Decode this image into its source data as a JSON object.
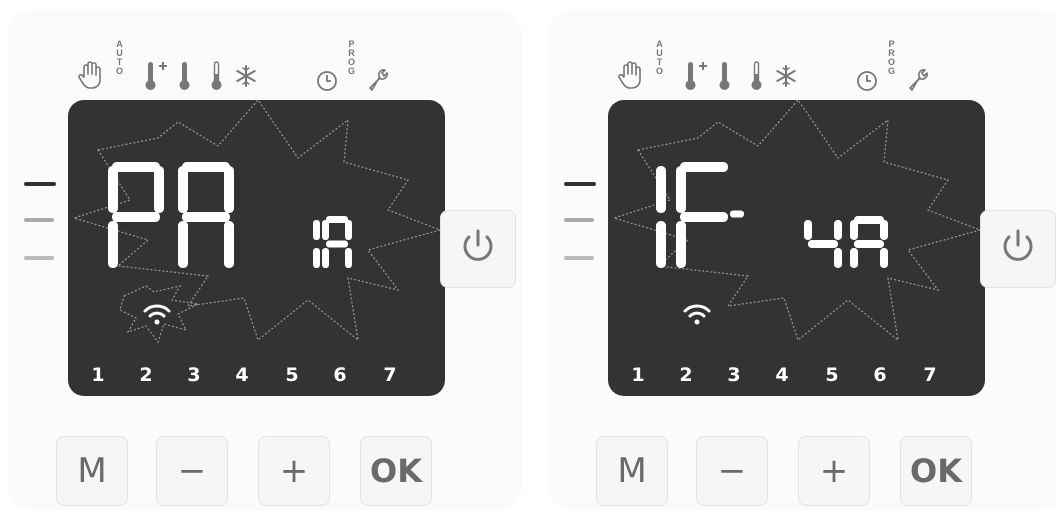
{
  "panels": [
    {
      "id": "left",
      "indicators": {
        "manual": "hand-icon",
        "auto_letters": [
          "A",
          "U",
          "T",
          "O"
        ],
        "comfort_plus": "thermometer-plus-icon",
        "comfort": "thermometer-icon",
        "eco": "thermometer-low-icon",
        "frost": "snowflake-icon",
        "clock": "clock-icon",
        "prog_letters": [
          "P",
          "R",
          "O",
          "G"
        ],
        "settings": "wrench-icon"
      },
      "display": {
        "main_text": "PA",
        "sub_text": "IR",
        "blinking": true
      },
      "days": [
        "1",
        "2",
        "3",
        "4",
        "5",
        "6",
        "7"
      ],
      "wifi": "wifi-icon",
      "power": "power-icon",
      "buttons": {
        "mode": "M",
        "minus": "−",
        "plus": "+",
        "ok": "OK"
      }
    },
    {
      "id": "right",
      "indicators": {
        "manual": "hand-icon",
        "auto_letters": [
          "A",
          "U",
          "T",
          "O"
        ],
        "comfort_plus": "thermometer-plus-icon",
        "comfort": "thermometer-icon",
        "eco": "thermometer-low-icon",
        "frost": "snowflake-icon",
        "clock": "clock-icon",
        "prog_letters": [
          "P",
          "R",
          "O",
          "G"
        ],
        "settings": "wrench-icon"
      },
      "display": {
        "main_text": "IF-",
        "sub_text": "4A",
        "blinking": true
      },
      "days": [
        "1",
        "2",
        "3",
        "4",
        "5",
        "6",
        "7"
      ],
      "wifi": "wifi-icon",
      "power": "power-icon",
      "buttons": {
        "mode": "M",
        "minus": "−",
        "plus": "+",
        "ok": "OK"
      }
    }
  ],
  "colors": {
    "lcd_bg": "#333333",
    "segment": "#ffffff",
    "icon": "#8a8a8a",
    "button_text": "#6a6a6a"
  }
}
